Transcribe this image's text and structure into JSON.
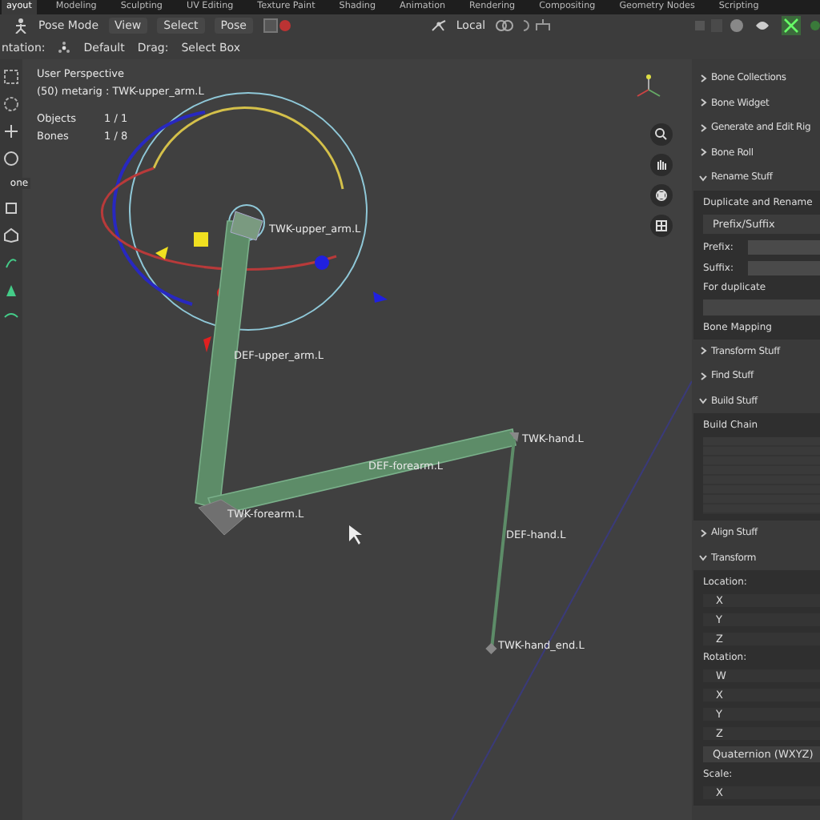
{
  "workspaces": [
    {
      "label": "ayout",
      "selected": true
    },
    {
      "label": "Modeling",
      "selected": false
    },
    {
      "label": "Sculpting",
      "selected": false
    },
    {
      "label": "UV Editing",
      "selected": false
    },
    {
      "label": "Texture Paint",
      "selected": false
    },
    {
      "label": "Shading",
      "selected": false
    },
    {
      "label": "Animation",
      "selected": false
    },
    {
      "label": "Rendering",
      "selected": false
    },
    {
      "label": "Compositing",
      "selected": false
    },
    {
      "label": "Geometry Nodes",
      "selected": false
    },
    {
      "label": "Scripting",
      "selected": false
    }
  ],
  "header": {
    "mode": "Pose Mode",
    "menus": [
      "View",
      "Select",
      "Pose"
    ],
    "pivot": "Local"
  },
  "tool_settings": {
    "orientation_label": "ntation:",
    "orientation": "Default",
    "drag_label": "Drag:",
    "drag": "Select Box"
  },
  "toolbar": {
    "tool_hint": "one"
  },
  "viewport": {
    "view": "User Perspective",
    "context": "(50) metarig : TWK-upper_arm.L",
    "stats": [
      {
        "label": "Objects",
        "value": "1 / 1"
      },
      {
        "label": "Bones",
        "value": "1 / 8"
      }
    ],
    "bone_labels": [
      "TWK-upper_arm.L",
      "DEF-upper_arm.L",
      "DEF-forearm.L",
      "TWK-hand.L",
      "TWK-forearm.L",
      "DEF-hand.L",
      "TWK-hand_end.L"
    ]
  },
  "sidebar": {
    "panels": [
      {
        "title": "Bone Collections",
        "expanded": false
      },
      {
        "title": "Bone Widget",
        "expanded": false
      },
      {
        "title": "Generate and Edit Rig",
        "expanded": false
      },
      {
        "title": "Bone Roll",
        "expanded": false
      },
      {
        "title": "Rename Stuff",
        "expanded": true,
        "content": [
          {
            "kind": "label",
            "text": "Duplicate and Rename"
          },
          {
            "kind": "tab",
            "text": "Prefix/Suffix"
          },
          {
            "kind": "field",
            "text": "Prefix:"
          },
          {
            "kind": "field",
            "text": "Suffix:"
          },
          {
            "kind": "label",
            "text": "For duplicate"
          },
          {
            "kind": "box"
          },
          {
            "kind": "label",
            "text": "Bone Mapping"
          }
        ]
      },
      {
        "title": "Transform Stuff",
        "expanded": false
      },
      {
        "title": "Find Stuff",
        "expanded": false
      },
      {
        "title": "Build Stuff",
        "expanded": true,
        "content": [
          {
            "kind": "label",
            "text": "Build Chain"
          },
          {
            "kind": "list"
          }
        ]
      },
      {
        "title": "Align Stuff",
        "expanded": false
      },
      {
        "title": "Transform",
        "expanded": true,
        "content": [
          {
            "kind": "label",
            "text": "Location:"
          },
          {
            "kind": "axis",
            "text": "X"
          },
          {
            "kind": "axis",
            "text": "Y"
          },
          {
            "kind": "axis",
            "text": "Z"
          },
          {
            "kind": "label",
            "text": "Rotation:"
          },
          {
            "kind": "axis",
            "text": "W"
          },
          {
            "kind": "axis",
            "text": "X"
          },
          {
            "kind": "axis",
            "text": "Y"
          },
          {
            "kind": "axis",
            "text": "Z"
          },
          {
            "kind": "dropdown",
            "text": "Quaternion (WXYZ)"
          },
          {
            "kind": "label",
            "text": "Scale:"
          },
          {
            "kind": "axis",
            "text": "X"
          }
        ]
      }
    ]
  }
}
